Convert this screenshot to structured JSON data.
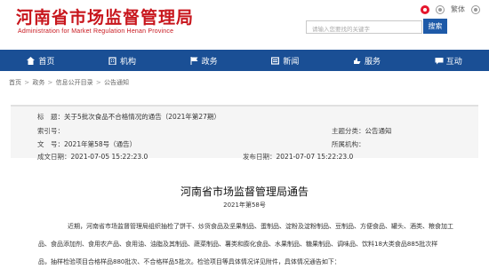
{
  "header": {
    "logo_cn": "河南省市场监督管理局",
    "logo_en": "Administration for Market Regulation Henan Province",
    "links": {
      "traditional": "繁体",
      "wechat": ""
    },
    "search": {
      "placeholder": "请输入您要找的关键字",
      "button": "搜索"
    }
  },
  "nav": {
    "items": [
      {
        "label": "首页",
        "icon": "home-icon"
      },
      {
        "label": "机构",
        "icon": "building-icon"
      },
      {
        "label": "政务",
        "icon": "flag-icon"
      },
      {
        "label": "新闻",
        "icon": "newspaper-icon"
      },
      {
        "label": "服务",
        "icon": "hand-icon"
      },
      {
        "label": "互动",
        "icon": "chat-icon"
      }
    ]
  },
  "breadcrumb": [
    "首页",
    "政务",
    "信息公开目录",
    "公告通知"
  ],
  "meta": {
    "title_label": "标　题：",
    "title_value": "关于5批次食品不合格情况的通告（2021年第27期）",
    "index_label": "索引号：",
    "index_value": "",
    "category_label": "主题分类：",
    "category_value": "公告通知",
    "docno_label": "文　号：",
    "docno_value": "2021年第58号（通告）",
    "org_label": "所属机构：",
    "org_value": "",
    "created_label": "成文日期：",
    "created_value": "2021-07-05 15:22:23.0",
    "published_label": "发布日期：",
    "published_value": "2021-07-07 15:22:23.0"
  },
  "article": {
    "title": "河南省市场监督管理局通告",
    "number": "2021年第58号",
    "lines": [
      "近期，河南省市场监督管理局组织抽检了饼干、炒货食品及坚果制品、蛋制品、淀粉及淀粉制品、豆制品、方便食品、罐头、酒类、粮食加工",
      "品、食品添加剂、食用农产品、食用油、油脂及其制品、蔬菜制品、薯类和膨化食品、水果制品、糖果制品、调味品、饮料18大类食品885批次样",
      "品，抽样检验项目合格样品880批次、不合格样品5批次。检验项目等具体情况详见附件，具体情况通告如下："
    ]
  }
}
